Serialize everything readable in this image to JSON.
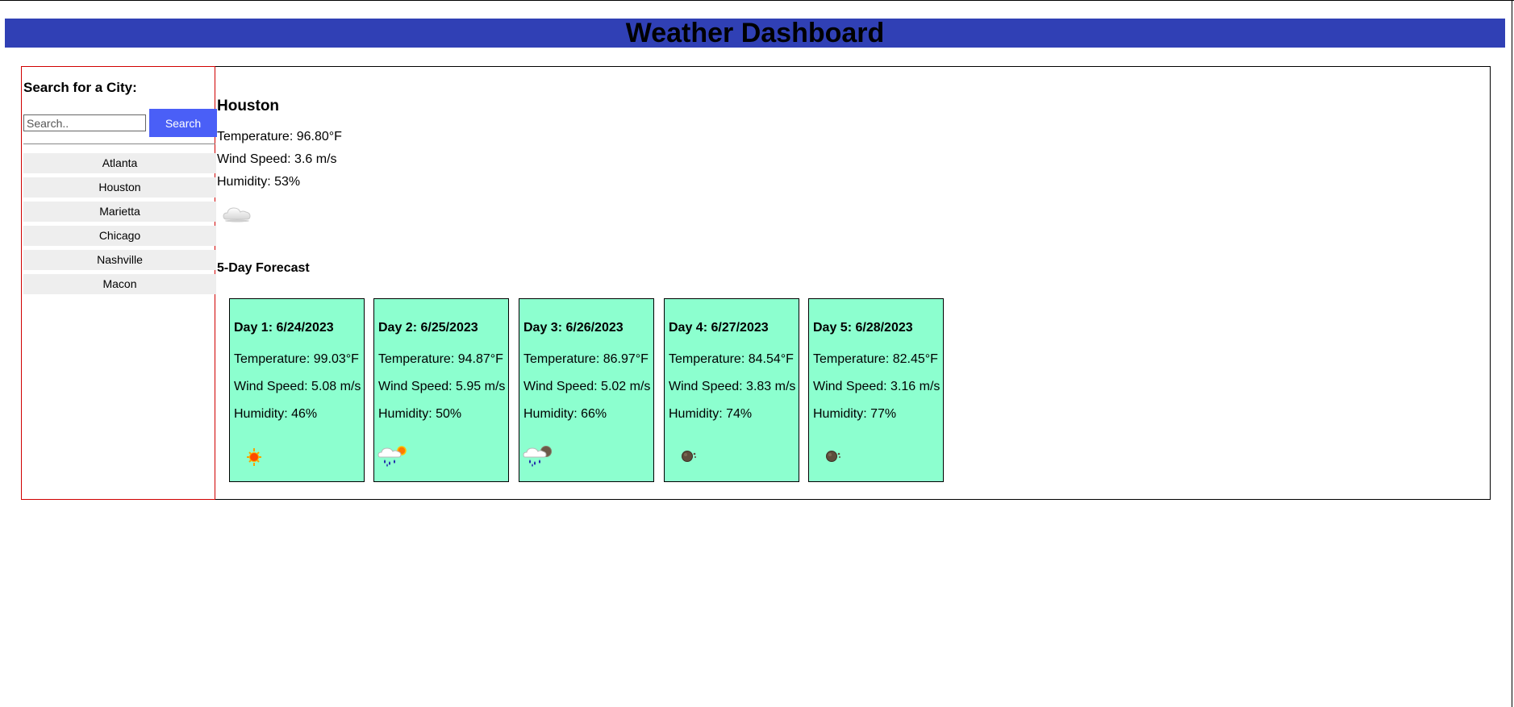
{
  "header": {
    "title": "Weather Dashboard"
  },
  "sidebar": {
    "heading": "Search for a City:",
    "search_placeholder": "Search..",
    "search_button": "Search",
    "cities": [
      "Atlanta",
      "Houston",
      "Marietta",
      "Chicago",
      "Nashville",
      "Macon"
    ]
  },
  "current": {
    "city": "Houston",
    "temperature": "Temperature: 96.80°F",
    "wind": "Wind Speed: 3.6 m/s",
    "humidity": "Humidity: 53%",
    "icon": "cloud-icon"
  },
  "forecast": {
    "title": "5-Day Forecast",
    "days": [
      {
        "date": "Day 1: 6/24/2023",
        "temperature": "Temperature: 99.03°F",
        "wind": "Wind Speed: 5.08 m/s",
        "humidity": "Humidity: 46%",
        "icon": "sun-icon"
      },
      {
        "date": "Day 2: 6/25/2023",
        "temperature": "Temperature: 94.87°F",
        "wind": "Wind Speed: 5.95 m/s",
        "humidity": "Humidity: 50%",
        "icon": "rain-sun-icon"
      },
      {
        "date": "Day 3: 6/26/2023",
        "temperature": "Temperature: 86.97°F",
        "wind": "Wind Speed: 5.02 m/s",
        "humidity": "Humidity: 66%",
        "icon": "rain-moon-icon"
      },
      {
        "date": "Day 4: 6/27/2023",
        "temperature": "Temperature: 84.54°F",
        "wind": "Wind Speed: 3.83 m/s",
        "humidity": "Humidity: 74%",
        "icon": "moon-icon"
      },
      {
        "date": "Day 5: 6/28/2023",
        "temperature": "Temperature: 82.45°F",
        "wind": "Wind Speed: 3.16 m/s",
        "humidity": "Humidity: 77%",
        "icon": "moon-icon"
      }
    ]
  }
}
